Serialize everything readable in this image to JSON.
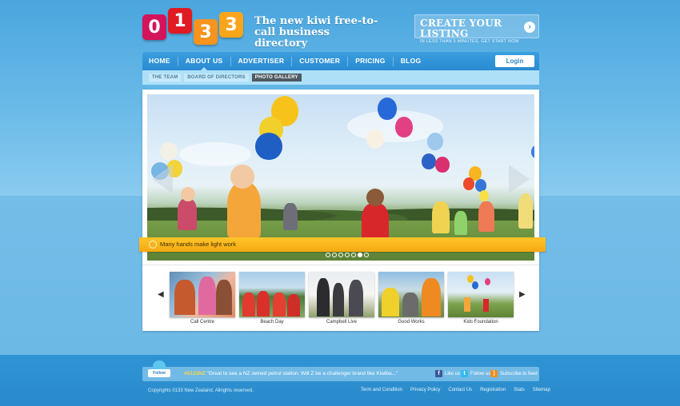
{
  "logo": {
    "digits": [
      "0",
      "1",
      "3",
      "3"
    ]
  },
  "header": {
    "tagline": "The new kiwi free-to-call business directory",
    "cta_title": "CREATE YOUR LISTING",
    "cta_subtitle": "IN LESS THAN 5 MINUTES, GET START NOW",
    "cta_arrow": "›"
  },
  "nav": {
    "items": [
      {
        "label": "HOME"
      },
      {
        "label": "ABOUT US"
      },
      {
        "label": "ADVERTISER"
      },
      {
        "label": "CUSTOMER"
      },
      {
        "label": "PRICING"
      },
      {
        "label": "BLOG"
      }
    ],
    "active": "ABOUT US",
    "login_label": "Login"
  },
  "subnav": {
    "items": [
      {
        "label": "THE TEAM"
      },
      {
        "label": "BOARD OF DIRECTORS"
      },
      {
        "label": "PHOTO GALLERY"
      }
    ],
    "active": "PHOTO GALLERY"
  },
  "slider": {
    "caption": "Many hands make light work",
    "dot_count": 7,
    "active_dot": 6
  },
  "gallery": {
    "prev": "◀",
    "next": "▶",
    "items": [
      {
        "label": "Call Centre"
      },
      {
        "label": "Beach Day"
      },
      {
        "label": "Campbell Live"
      },
      {
        "label": "Good Works"
      },
      {
        "label": "Kids Foundation"
      }
    ]
  },
  "footer": {
    "follow_badge": "Follow",
    "tweet_handle": "#0133NZ",
    "tweet_text": " \"Great to see a NZ owned petrol station. Will Z be a challenger brand like Kiwiba...\"",
    "social": [
      {
        "label": "Like us",
        "icon": "facebook-icon",
        "glyph": "f",
        "color": "#3b5998"
      },
      {
        "label": "Follow us",
        "icon": "twitter-icon",
        "glyph": "t",
        "color": "#33bbee"
      },
      {
        "label": "Subscribe to feed",
        "icon": "rss-icon",
        "glyph": ")",
        "color": "#f28c1c"
      }
    ],
    "copyright": "Copyrights 0133 New Zealand. Allrights reserved.",
    "links": [
      {
        "label": "Term and Condition"
      },
      {
        "label": "Privacy Policy"
      },
      {
        "label": "Contact Us"
      },
      {
        "label": "Registration"
      },
      {
        "label": "Stats"
      },
      {
        "label": "Sitemap"
      }
    ]
  },
  "colors": {
    "brand_red": "#e01b23",
    "brand_pink": "#d4145a",
    "brand_orange": "#f7941d",
    "nav_blue": "#2a8ad0",
    "caption_yellow": "#f4a912"
  }
}
